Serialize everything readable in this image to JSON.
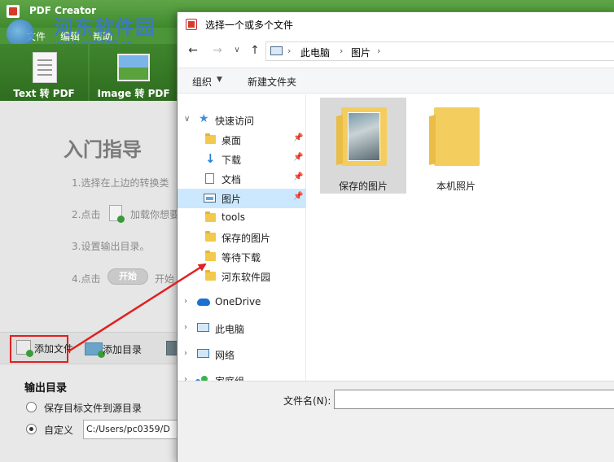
{
  "app": {
    "title": "PDF Creator",
    "watermark_text": "河东软件园",
    "watermark_url": "www.pc0359.cn",
    "menu": {
      "file": "文件",
      "edit": "编辑",
      "help": "帮助"
    },
    "tabs": {
      "text_pdf": "Text 转 PDF",
      "image_pdf": "Image 转 PDF"
    },
    "guide": {
      "title": "入门指导",
      "step1": "1.选择在上边的转换类",
      "step2_prefix": "2.点击",
      "step2_suffix": "加载你想要",
      "step3": "3.设置输出目录。",
      "step4_prefix": "4.点击",
      "step4_button": "开始",
      "step4_suffix": "开始"
    },
    "toolbar": {
      "add_file": "添加文件",
      "add_dir": "添加目录"
    },
    "output": {
      "heading": "输出目录",
      "option_source": "保存目标文件到源目录",
      "option_custom": "自定义",
      "path": "C:/Users/pc0359/D"
    }
  },
  "dialog": {
    "title": "选择一个或多个文件",
    "breadcrumb": [
      "此电脑",
      "图片"
    ],
    "commands": {
      "organize": "组织",
      "new_folder": "新建文件夹"
    },
    "nav": {
      "quick_access": "快速访问",
      "desktop": "桌面",
      "downloads": "下载",
      "documents": "文档",
      "pictures": "图片",
      "tools": "tools",
      "saved_pictures": "保存的图片",
      "pending_downloads": "等待下载",
      "hedong": "河东软件园",
      "onedrive": "OneDrive",
      "this_pc": "此电脑",
      "network": "网络",
      "homegroup": "家庭组"
    },
    "items": [
      "保存的图片",
      "本机照片"
    ],
    "filename_label": "文件名(N):",
    "filename_value": ""
  },
  "colors": {
    "accent_green": "#4c9639",
    "selection_blue": "#cce8ff",
    "annotation_red": "#e02020"
  }
}
